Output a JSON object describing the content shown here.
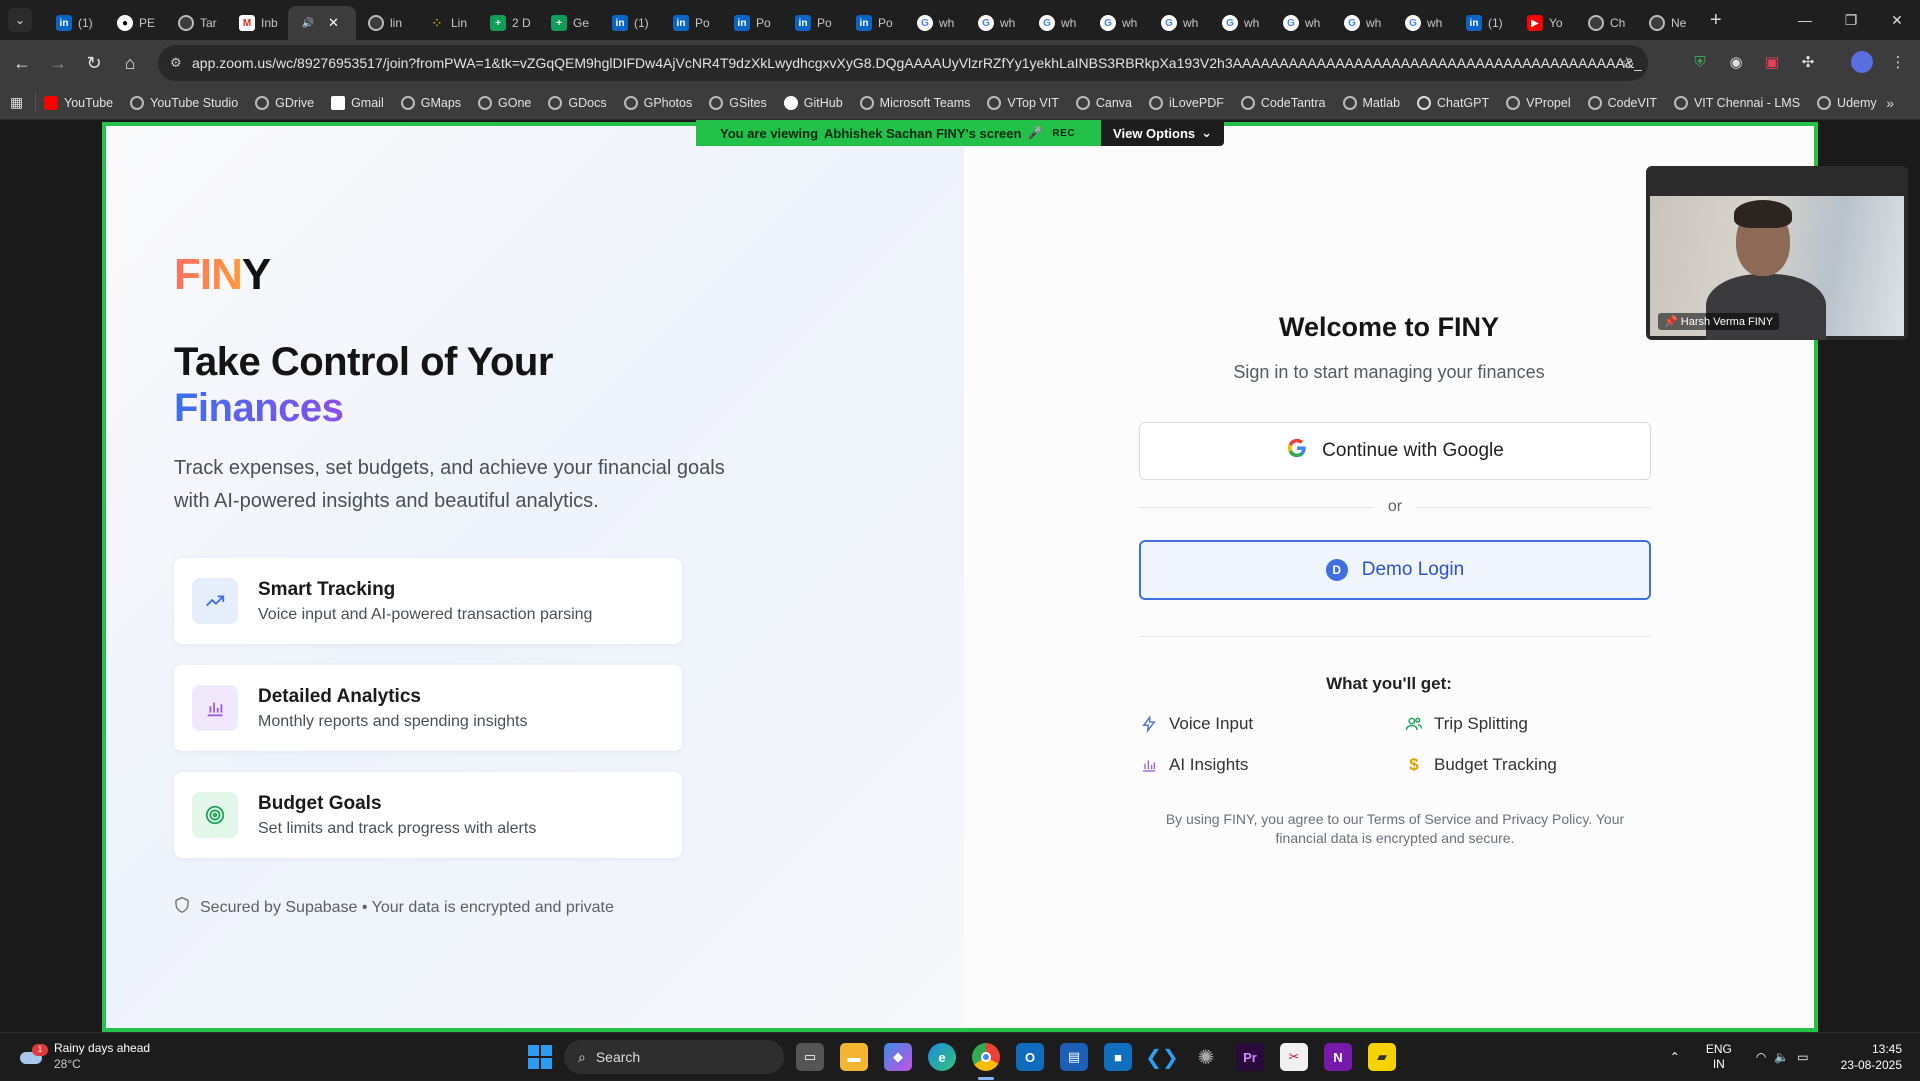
{
  "browser": {
    "tabs": [
      {
        "icon": "linkedin-icon",
        "label": "(1)"
      },
      {
        "icon": "github-icon",
        "label": "PE"
      },
      {
        "icon": "globe-icon",
        "label": "Tar"
      },
      {
        "icon": "gmail-icon",
        "label": "Inb"
      },
      {
        "icon": "speaker-icon",
        "label": "",
        "active": true
      },
      {
        "icon": "globe-icon",
        "label": "lin"
      },
      {
        "icon": "dots-icon",
        "label": "Lin"
      },
      {
        "icon": "sheets-icon",
        "label": "2 D"
      },
      {
        "icon": "sheets-icon",
        "label": "Ge"
      },
      {
        "icon": "linkedin-icon",
        "label": "(1)"
      },
      {
        "icon": "linkedin-icon",
        "label": "Po"
      },
      {
        "icon": "linkedin-icon",
        "label": "Po"
      },
      {
        "icon": "linkedin-icon",
        "label": "Po"
      },
      {
        "icon": "linkedin-icon",
        "label": "Po"
      },
      {
        "icon": "google-icon",
        "label": "wh"
      },
      {
        "icon": "google-icon",
        "label": "wh"
      },
      {
        "icon": "google-icon",
        "label": "wh"
      },
      {
        "icon": "google-icon",
        "label": "wh"
      },
      {
        "icon": "google-icon",
        "label": "wh"
      },
      {
        "icon": "google-icon",
        "label": "wh"
      },
      {
        "icon": "google-icon",
        "label": "wh"
      },
      {
        "icon": "google-icon",
        "label": "wh"
      },
      {
        "icon": "google-icon",
        "label": "wh"
      },
      {
        "icon": "linkedin-icon",
        "label": "(1)"
      },
      {
        "icon": "youtube-icon",
        "label": "Yo"
      },
      {
        "icon": "chatgpt-icon",
        "label": "Ch"
      },
      {
        "icon": "chatgpt-icon",
        "label": "Ne"
      }
    ],
    "url": "app.zoom.us/wc/89276953517/join?fromPWA=1&tk=vZGqQEM9hglDIFDw4AjVcNR4T9dzXkLwydhcgxvXyG8.DQgAAAAUyVlzrRZfYy1yekhLaINBS3RBRkpXa193V2h3AAAAAAAAAAAAAAAAAAAAAAAAAAAAAAAAAAAAAAAAAA&_x_zm_r...",
    "bookmarks": [
      "YouTube",
      "YouTube Studio",
      "GDrive",
      "Gmail",
      "GMaps",
      "GOne",
      "GDocs",
      "GPhotos",
      "GSites",
      "GitHub",
      "Microsoft Teams",
      "VTop VIT",
      "Canva",
      "iLovePDF",
      "CodeTantra",
      "Matlab",
      "ChatGPT",
      "VPropel",
      "CodeVIT",
      "VIT Chennai - LMS",
      "Udemy"
    ]
  },
  "zoom": {
    "banner_prefix": "You are viewing",
    "banner_name": "Abhishek Sachan FINY's screen",
    "rec": "REC",
    "view_options": "View Options",
    "participant_name": "Harsh Verma FINY"
  },
  "app": {
    "logo_fin": "FIN",
    "logo_y": "Y",
    "hero_line1": "Take Control of Your",
    "hero_line2": "Finances",
    "subtext": "Track expenses, set budgets, and achieve your financial goals with AI-powered insights and beautiful analytics.",
    "features": [
      {
        "title": "Smart Tracking",
        "desc": "Voice input and AI-powered transaction parsing"
      },
      {
        "title": "Detailed Analytics",
        "desc": "Monthly reports and spending insights"
      },
      {
        "title": "Budget Goals",
        "desc": "Set limits and track progress with alerts"
      }
    ],
    "secured": "Secured by Supabase • Your data is encrypted and private",
    "welcome": "Welcome to FINY",
    "signin": "Sign in to start managing your finances",
    "google_btn": "Continue with Google",
    "or": "or",
    "demo_btn": "Demo Login",
    "demo_letter": "D",
    "get_title": "What you'll get:",
    "benefits": [
      "Voice Input",
      "Trip Splitting",
      "AI Insights",
      "Budget Tracking"
    ],
    "legal": "By using FINY, you agree to our Terms of Service and Privacy Policy. Your financial data is encrypted and secure.",
    "colors": {
      "accent_blue": "#3f6fe0",
      "zoom_green": "#23c14a",
      "logo_orange": "#ff6f61",
      "hero_purple": "#8a4fe8"
    }
  },
  "taskbar": {
    "weather_title": "Rainy days ahead",
    "weather_temp": "28°C",
    "weather_badge": "1",
    "search": "Search",
    "lang1": "ENG",
    "lang2": "IN",
    "time": "13:45",
    "date": "23-08-2025"
  }
}
